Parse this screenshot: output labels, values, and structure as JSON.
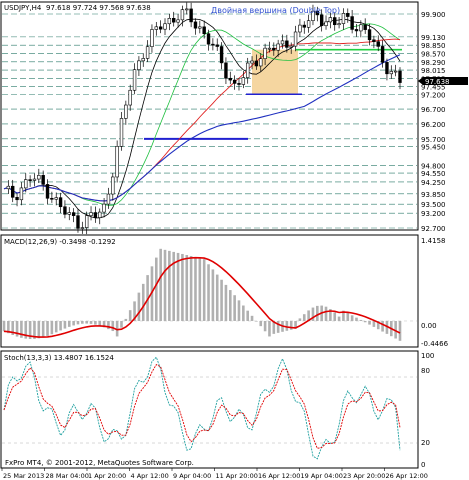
{
  "header": {
    "symbol": "USDJPY,H4",
    "ohlc": "97.618 97.724 97.568 97.638",
    "pattern_label": "Двойная вершина (Double Top)"
  },
  "price_axis": {
    "ticks": [
      "99.900",
      "99.130",
      "98.850",
      "98.570",
      "98.290",
      "98.015",
      "97.735",
      "97.455",
      "97.200",
      "96.700",
      "96.200",
      "95.700",
      "95.450",
      "94.800",
      "94.550",
      "94.250",
      "93.850",
      "93.500",
      "93.200",
      "92.700"
    ],
    "current_price": "97.638"
  },
  "macd": {
    "label": "MACD(12,26,9) -0.3498 -0.1292",
    "max_label": "1.4158",
    "zero_label": "0.00",
    "min_label": "-0.4466"
  },
  "stoch": {
    "label": "Stoch(13,3,3) 13.4807 16.1524",
    "levels": [
      "100",
      "80",
      "20",
      "0"
    ]
  },
  "footer": {
    "copyright": "FxPro MT4, © 2001-2012, MetaQuotes Software Corp."
  },
  "time_axis": {
    "labels": [
      "25 Mar 2013",
      "28 Mar 04:00",
      "1 Apr 20:00",
      "4 Apr 12:00",
      "9 Apr 04:00",
      "11 Apr 20:00",
      "16 Apr 12:00",
      "19 Apr 04:00",
      "23 Apr 20:00",
      "26 Apr 12:00"
    ]
  },
  "colors": {
    "grid_level": "#2a7a6a",
    "bull_candle": "#ffffff",
    "bear_candle": "#000000",
    "macd_hist": "#b0b0b0",
    "macd_signal": "#e00000",
    "stoch_main": "#20a0a0",
    "stoch_signal": "#e00000",
    "ma_black": "#000000",
    "ma_red": "#e02020",
    "ma_blue": "#2030c0",
    "ma_green": "#20c040",
    "level_green": "#20d040",
    "level_blue": "#2020d0",
    "range_box": "#f5d6a0",
    "pattern_text": "#3050d0"
  },
  "icons": {
    "current_price_marker": "price-arrow-icon"
  },
  "chart_data": [
    {
      "type": "line",
      "title": "USDJPY,H4",
      "series": [
        {
          "values": [
            93.9,
            93.8,
            94.1,
            94.4,
            94.2,
            93.9,
            93.4,
            93.1,
            92.9,
            93.0,
            93.1,
            93.4,
            95.0,
            96.5,
            97.8,
            98.6,
            99.1,
            99.5,
            99.7,
            99.9,
            99.8,
            99.5,
            99.2,
            98.6,
            98.0,
            97.5,
            97.8,
            98.2,
            98.6,
            98.8,
            98.7,
            99.0,
            99.4,
            99.6,
            99.9,
            99.7,
            99.5,
            99.8,
            99.6,
            99.3,
            99.0,
            98.5,
            97.9,
            97.6
          ]
        }
      ],
      "ylim": [
        92.7,
        99.9
      ],
      "annotations": [
        "Двойная вершина (Double Top)"
      ]
    },
    {
      "type": "bar",
      "title": "MACD(12,26,9) -0.3498 -0.1292",
      "ylim": [
        -0.4466,
        1.4158
      ]
    },
    {
      "type": "line",
      "title": "Stoch(13,3,3) 13.4807 16.1524",
      "ylim": [
        0,
        100
      ]
    }
  ]
}
